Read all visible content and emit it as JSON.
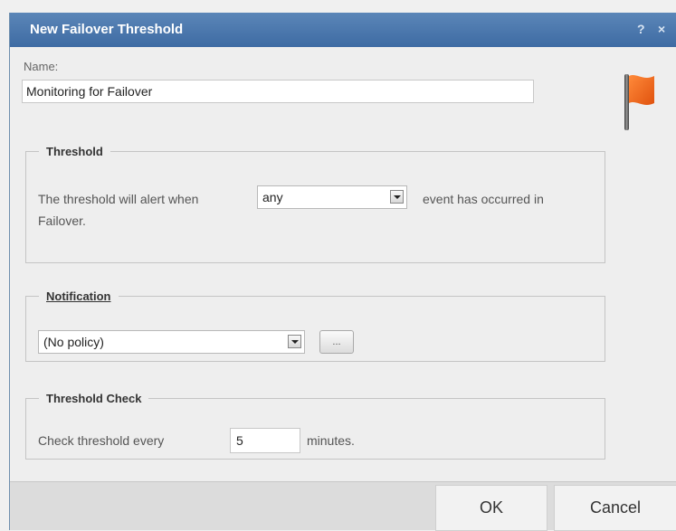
{
  "dialog": {
    "title": "New Failover Threshold",
    "help_label": "?",
    "close_label": "×"
  },
  "name": {
    "label": "Name:",
    "value": "Monitoring for Failover"
  },
  "threshold": {
    "legend": "Threshold",
    "text_before": "The threshold will alert when",
    "selected": "any",
    "text_after_line1": "event has occurred in",
    "text_after_line2": "Failover."
  },
  "notification": {
    "legend": "Notification",
    "selected": "(No policy)",
    "browse_label": "..."
  },
  "threshold_check": {
    "legend": "Threshold Check",
    "text_before": "Check threshold every",
    "value": "5",
    "text_after": "minutes."
  },
  "footer": {
    "ok_label": "OK",
    "cancel_label": "Cancel"
  },
  "icons": {
    "flag": "flag-icon"
  },
  "colors": {
    "titlebar": "#4a77ad",
    "flag": "#f26a1b"
  }
}
